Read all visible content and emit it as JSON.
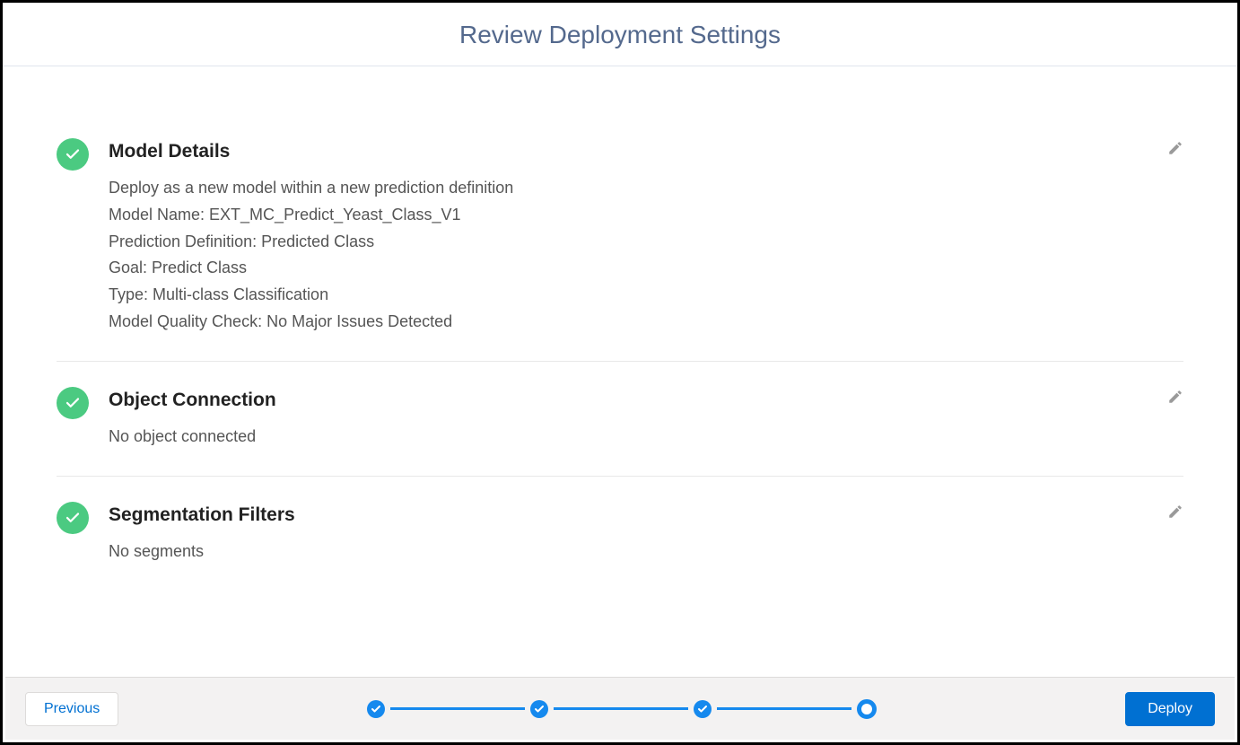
{
  "page": {
    "title": "Review Deployment Settings"
  },
  "sections": {
    "model_details": {
      "heading": "Model Details",
      "lines": [
        "Deploy as a new model within a new prediction definition",
        "Model Name: EXT_MC_Predict_Yeast_Class_V1",
        "Prediction Definition: Predicted Class",
        "Goal: Predict Class",
        "Type: Multi-class Classification",
        "Model Quality Check: No Major Issues Detected"
      ]
    },
    "object_connection": {
      "heading": "Object Connection",
      "lines": [
        "No object connected"
      ]
    },
    "segmentation_filters": {
      "heading": "Segmentation Filters",
      "lines": [
        "No segments"
      ]
    }
  },
  "footer": {
    "previous_label": "Previous",
    "deploy_label": "Deploy",
    "steps": {
      "total": 4,
      "completed": 3,
      "current_index": 3
    }
  },
  "colors": {
    "accent": "#1589ee",
    "success": "#4bca81",
    "primary_button": "#0070d2"
  }
}
